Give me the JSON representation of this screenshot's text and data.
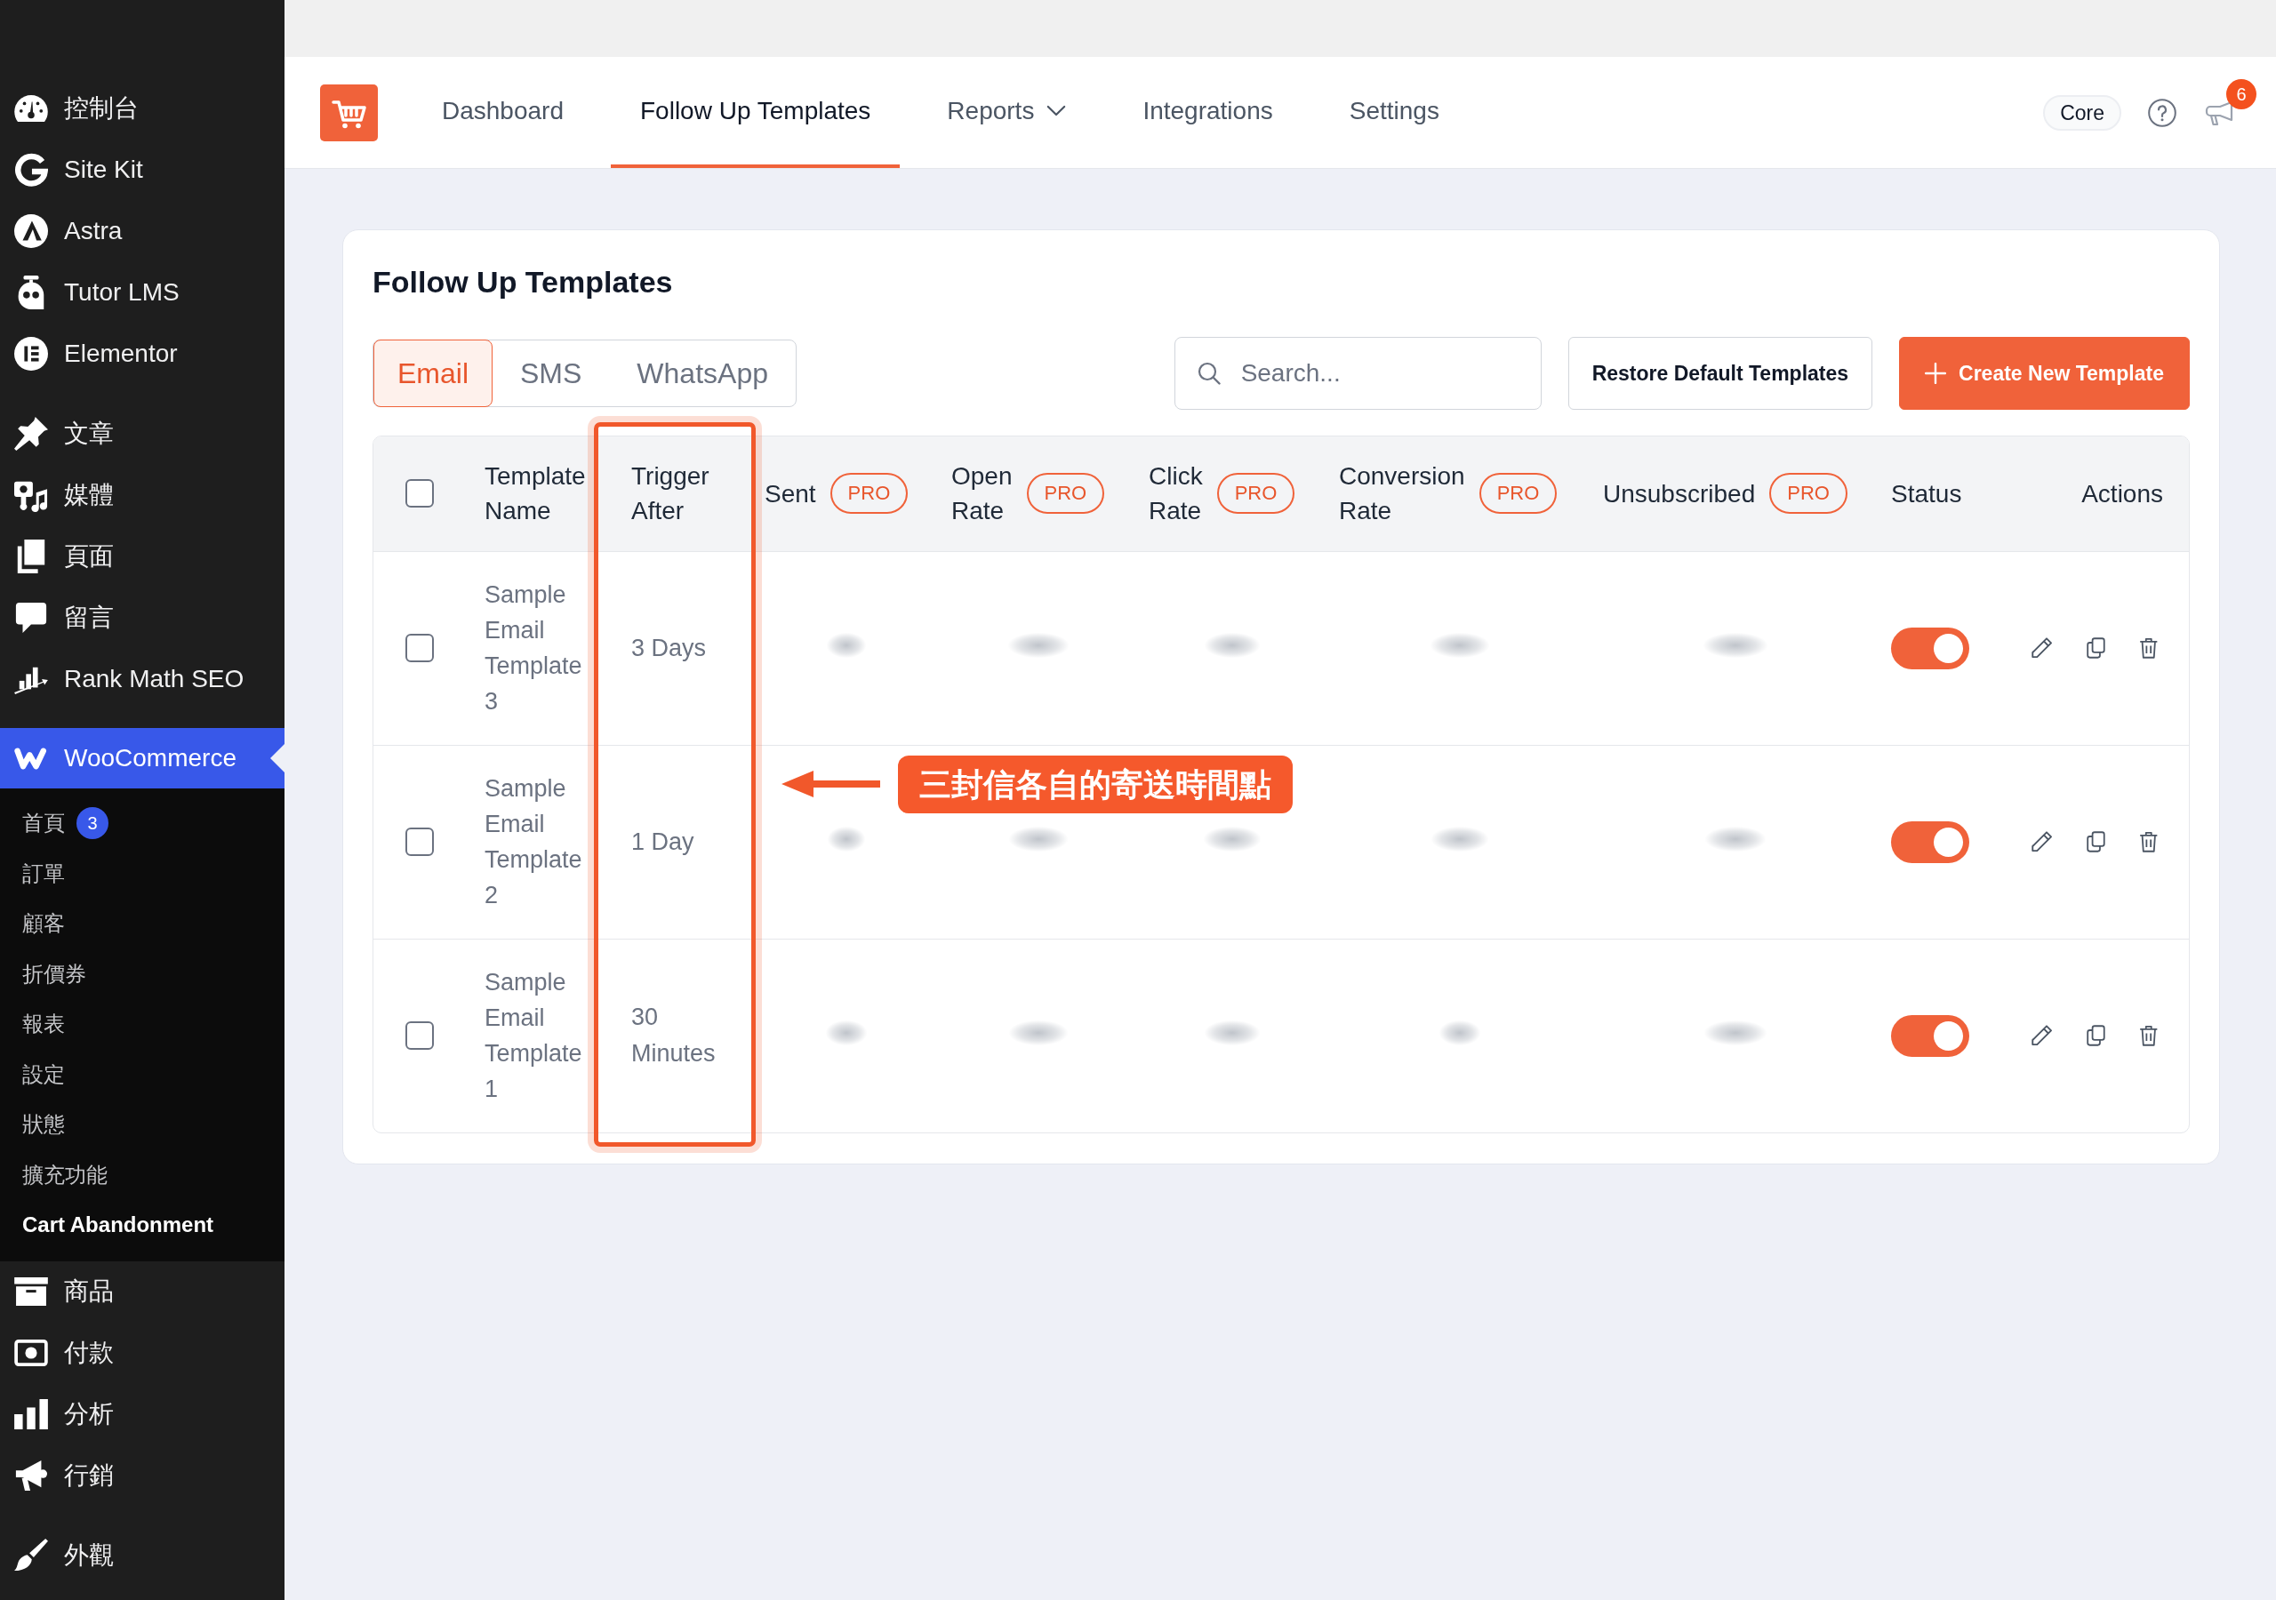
{
  "sidebar": {
    "groups": [
      {
        "items": [
          {
            "label": "控制台",
            "selected": false
          },
          {
            "label": "Site Kit",
            "selected": false
          },
          {
            "label": "Astra",
            "selected": false
          },
          {
            "label": "Tutor LMS",
            "selected": false
          },
          {
            "label": "Elementor",
            "selected": false
          }
        ]
      },
      {
        "items": [
          {
            "label": "文章",
            "selected": false
          },
          {
            "label": "媒體",
            "selected": false
          },
          {
            "label": "頁面",
            "selected": false
          },
          {
            "label": "留言",
            "selected": false
          },
          {
            "label": "Rank Math SEO",
            "selected": false
          }
        ]
      },
      {
        "items": [
          {
            "label": "WooCommerce",
            "selected": true,
            "children": [
              {
                "label": "首頁",
                "badge": "3",
                "selected": false
              },
              {
                "label": "訂單",
                "selected": false
              },
              {
                "label": "顧客",
                "selected": false
              },
              {
                "label": "折價券",
                "selected": false
              },
              {
                "label": "報表",
                "selected": false
              },
              {
                "label": "設定",
                "selected": false
              },
              {
                "label": "狀態",
                "selected": false
              },
              {
                "label": "擴充功能",
                "selected": false
              },
              {
                "label": "Cart Abandonment",
                "selected": true
              }
            ]
          },
          {
            "label": "商品",
            "selected": false
          },
          {
            "label": "付款",
            "selected": false
          },
          {
            "label": "分析",
            "selected": false
          },
          {
            "label": "行銷",
            "selected": false
          }
        ]
      },
      {
        "items": [
          {
            "label": "外觀",
            "selected": false
          }
        ]
      }
    ]
  },
  "header": {
    "nav": [
      {
        "label": "Dashboard",
        "kind": "link",
        "selected": false
      },
      {
        "label": "Follow Up Templates",
        "kind": "link",
        "selected": true
      },
      {
        "label": "Reports",
        "kind": "dropdown",
        "selected": false
      },
      {
        "label": "Integrations",
        "kind": "link",
        "selected": false
      },
      {
        "label": "Settings",
        "kind": "link",
        "selected": false
      }
    ],
    "plan": "Core",
    "notification_count": "6"
  },
  "page": {
    "title": "Follow Up Templates",
    "channel_tabs": [
      {
        "label": "Email",
        "selected": true
      },
      {
        "label": "SMS",
        "selected": false
      },
      {
        "label": "WhatsApp",
        "selected": false
      }
    ],
    "search": {
      "placeholder": "Search..."
    },
    "buttons": [
      {
        "label": "Restore Default Templates",
        "kind": "secondary"
      },
      {
        "label": "Create New Template",
        "kind": "primary"
      }
    ]
  },
  "table": {
    "select_all": {
      "checked": false
    },
    "columns": [
      {
        "label": "Template Name",
        "kind": "name",
        "highlighted": false
      },
      {
        "label": "Trigger After",
        "kind": "trigger",
        "highlighted": true
      },
      {
        "label": "Sent",
        "kind": "metric",
        "badge": "PRO",
        "highlighted": false
      },
      {
        "label": "Open Rate",
        "kind": "metric",
        "badge": "PRO",
        "highlighted": false
      },
      {
        "label": "Click Rate",
        "kind": "metric",
        "badge": "PRO",
        "highlighted": false
      },
      {
        "label": "Conversion Rate",
        "kind": "metric",
        "badge": "PRO",
        "highlighted": false
      },
      {
        "label": "Unsubscribed",
        "kind": "metric",
        "badge": "PRO",
        "highlighted": false
      },
      {
        "label": "Status",
        "kind": "status",
        "highlighted": false
      },
      {
        "label": "Actions",
        "kind": "actions",
        "highlighted": false
      }
    ],
    "rows": [
      {
        "checked": false,
        "name": "Sample Email Template 3",
        "trigger_after": "3 Days",
        "on": true
      },
      {
        "checked": false,
        "name": "Sample Email Template 2",
        "trigger_after": "1 Day",
        "on": true
      },
      {
        "checked": false,
        "name": "Sample Email Template 1",
        "trigger_after": "30 Minutes",
        "on": true
      }
    ]
  },
  "annotation": {
    "label": "三封信各自的寄送時間點"
  }
}
